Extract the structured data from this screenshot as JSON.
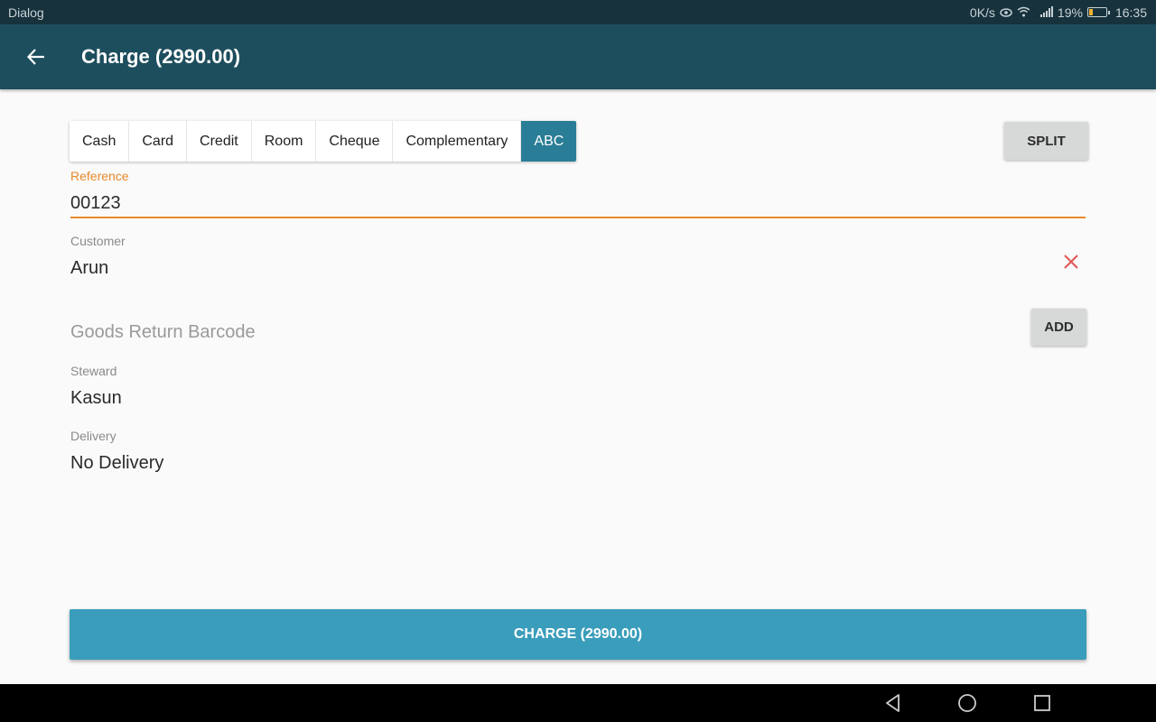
{
  "status_bar": {
    "carrier": "Dialog",
    "network_speed": "0K/s",
    "battery_percent": "19%",
    "time": "16:35",
    "icons": [
      "eye-icon",
      "wifi-icon",
      "signal-icon",
      "battery-charging-icon"
    ]
  },
  "app_bar": {
    "back_icon": "arrow-left-icon",
    "title": "Charge (2990.00)"
  },
  "payment_tabs": [
    {
      "label": "Cash",
      "active": false
    },
    {
      "label": "Card",
      "active": false
    },
    {
      "label": "Credit",
      "active": false
    },
    {
      "label": "Room",
      "active": false
    },
    {
      "label": "Cheque",
      "active": false
    },
    {
      "label": "Complementary",
      "active": false
    },
    {
      "label": "ABC",
      "active": true
    }
  ],
  "split_button": "SPLIT",
  "reference": {
    "label": "Reference",
    "value": "00123"
  },
  "customer": {
    "label": "Customer",
    "value": "Arun",
    "clear_icon": "close-icon"
  },
  "goods_return": {
    "placeholder": "Goods Return Barcode",
    "add_button": "ADD"
  },
  "steward": {
    "label": "Steward",
    "value": "Kasun"
  },
  "delivery": {
    "label": "Delivery",
    "value": "No Delivery"
  },
  "charge_button": "CHARGE (2990.00)",
  "nav_bar": {
    "icons": [
      "back-triangle-icon",
      "home-circle-icon",
      "recents-square-icon"
    ]
  },
  "colors": {
    "app_bar": "#1d4e5e",
    "status_bar": "#17323c",
    "accent_orange": "#e8892b",
    "active_tab": "#2a7d96",
    "charge_button": "#3a9dbb",
    "clear_red": "#e15b5b"
  }
}
